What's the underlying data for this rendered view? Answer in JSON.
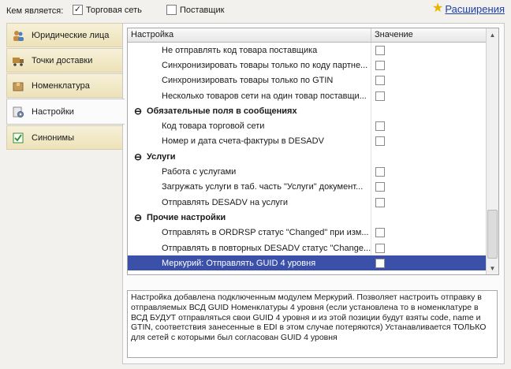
{
  "top": {
    "who_label": "Кем является:",
    "options": [
      {
        "label": "Торговая сеть",
        "checked": true
      },
      {
        "label": "Поставщик",
        "checked": false
      }
    ],
    "extensions_label": "Расширения"
  },
  "tabs": [
    {
      "label": "Юридические лица",
      "icon": "people-icon"
    },
    {
      "label": "Точки доставки",
      "icon": "truck-icon"
    },
    {
      "label": "Номенклатура",
      "icon": "box-icon"
    },
    {
      "label": "Настройки",
      "icon": "settings-icon",
      "active": true
    },
    {
      "label": "Синонимы",
      "icon": "checklist-icon"
    }
  ],
  "grid": {
    "col_setting": "Настройка",
    "col_value": "Значение",
    "rows": [
      {
        "type": "item",
        "label": "Не отправлять код товара поставщика"
      },
      {
        "type": "item",
        "label": "Синхронизировать товары только по коду партне..."
      },
      {
        "type": "item",
        "label": "Синхронизировать товары только по GTIN"
      },
      {
        "type": "item",
        "label": "Несколько товаров сети на один товар поставщи..."
      },
      {
        "type": "group",
        "label": "Обязательные поля в сообщениях"
      },
      {
        "type": "item",
        "label": "Код товара торговой сети"
      },
      {
        "type": "item",
        "label": "Номер и дата счета-фактуры в DESADV"
      },
      {
        "type": "group",
        "label": "Услуги"
      },
      {
        "type": "item",
        "label": "Работа с услугами"
      },
      {
        "type": "item",
        "label": "Загружать услуги в таб. часть \"Услуги\" документ..."
      },
      {
        "type": "item",
        "label": "Отправлять DESADV на услуги"
      },
      {
        "type": "group",
        "label": "Прочие настройки"
      },
      {
        "type": "item",
        "label": "Отправлять в ORDRSP статус \"Changed\" при изм..."
      },
      {
        "type": "item",
        "label": "Отправлять в повторных DESADV статус \"Change..."
      },
      {
        "type": "item",
        "label": "Меркурий: Отправлять GUID 4 уровня",
        "selected": true
      }
    ]
  },
  "description": "Настройка добавлена подключенным модулем Меркурий. Позволяет настроить отправку в отправляемых ВСД GUID Номенклатуры 4 уровня (если установлена то в номенклатуре в ВСД БУДУТ отправляться свои GUID 4 уровня и из этой позиции будут взяты code, name и GTIN, соответствия занесенные в EDI в этом случае потеряются) Устанавливается ТОЛЬКО для сетей с которыми был согласован GUID 4 уровня"
}
